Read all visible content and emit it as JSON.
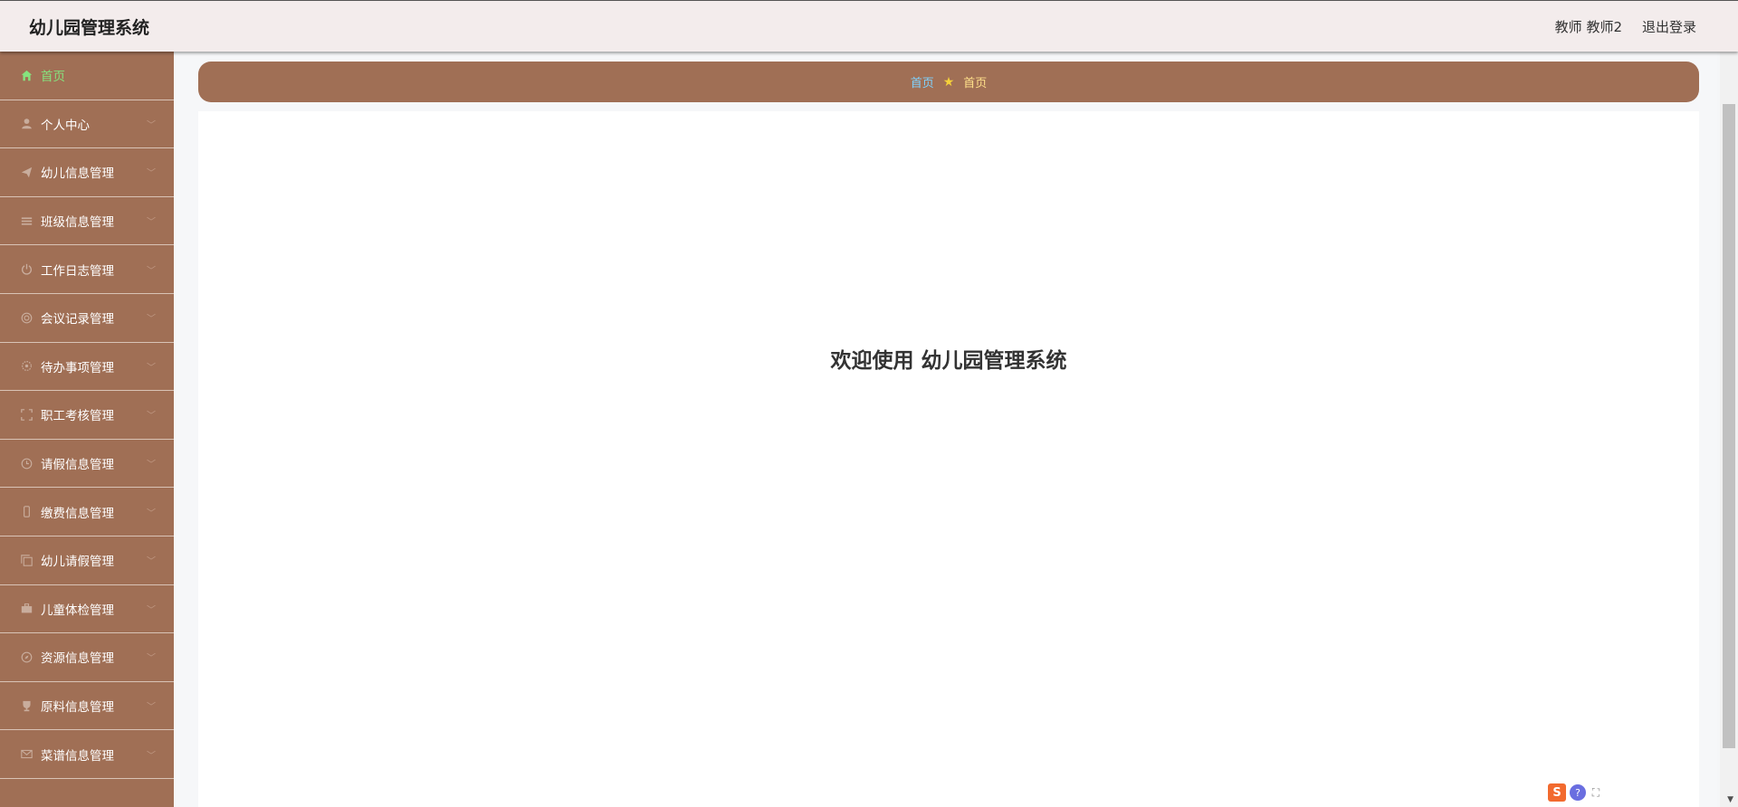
{
  "header": {
    "app_title": "幼儿园管理系统",
    "user_label": "教师 教师2",
    "logout_label": "退出登录"
  },
  "sidebar": {
    "items": [
      {
        "label": "首页",
        "icon": "home-icon",
        "active": true
      },
      {
        "label": "个人中心",
        "icon": "user-icon"
      },
      {
        "label": "幼儿信息管理",
        "icon": "paper-plane-icon"
      },
      {
        "label": "班级信息管理",
        "icon": "list-icon"
      },
      {
        "label": "工作日志管理",
        "icon": "power-icon"
      },
      {
        "label": "会议记录管理",
        "icon": "globe-icon"
      },
      {
        "label": "待办事项管理",
        "icon": "gear-icon"
      },
      {
        "label": "职工考核管理",
        "icon": "frame-icon"
      },
      {
        "label": "请假信息管理",
        "icon": "clock-icon"
      },
      {
        "label": "缴费信息管理",
        "icon": "phone-icon"
      },
      {
        "label": "幼儿请假管理",
        "icon": "copy-icon"
      },
      {
        "label": "儿童体检管理",
        "icon": "briefcase-icon"
      },
      {
        "label": "资源信息管理",
        "icon": "compass-icon"
      },
      {
        "label": "原料信息管理",
        "icon": "trophy-icon"
      },
      {
        "label": "菜谱信息管理",
        "icon": "mail-icon"
      }
    ]
  },
  "breadcrumb": {
    "home": "首页",
    "current": "首页"
  },
  "main": {
    "welcome": "欢迎使用 幼儿园管理系统"
  },
  "colors": {
    "accent": "#a06f55",
    "active_menu": "#86e37e",
    "header_bg": "#f3ecec"
  }
}
